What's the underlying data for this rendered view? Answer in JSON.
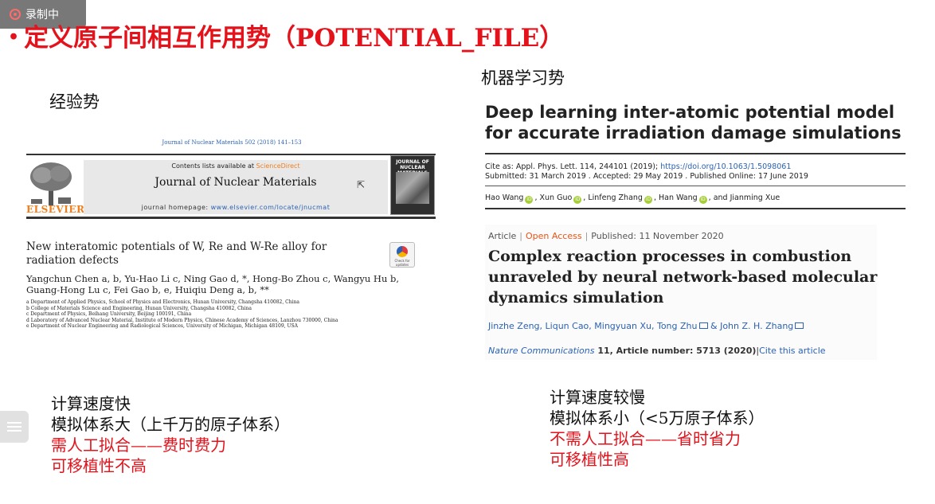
{
  "recording": {
    "label": "录制中"
  },
  "slide": {
    "bullet": "•",
    "title": "定义原子间相互作用势（POTENTIAL_FILE）",
    "left": {
      "heading": "经验势",
      "lines": [
        "计算速度快",
        "模拟体系大（上千万的原子体系）",
        "需人工拟合——费时费力",
        "可移植性不高"
      ]
    },
    "right": {
      "heading": "机器学习势",
      "lines": [
        "计算速度较慢",
        "模拟体系小（<5万原子体系）",
        "不需人工拟合——省时省力",
        "可移植性高"
      ]
    }
  },
  "paper1": {
    "journal_ref": "Journal of Nuclear Materials 502 (2018) 141–153",
    "contents_prefix": "Contents lists available at",
    "contents_link": "ScienceDirect",
    "journal_name": "Journal of Nuclear Materials",
    "homepage_prefix": "journal homepage:",
    "homepage_url": "www.elsevier.com/locate/jnucmat",
    "publisher": "ELSEVIER",
    "cover_title": "JOURNAL OF NUCLEAR MATERIALS",
    "title": "New interatomic potentials of W, Re and W-Re alloy for radiation defects",
    "crossmark": "Check for updates",
    "authors": "Yangchun Chen a, b, Yu-Hao Li c, Ning Gao d, *, Hong-Bo Zhou c, Wangyu Hu b, Guang-Hong Lu c, Fei Gao b, e, Huiqiu Deng a, b, **",
    "affiliations": [
      "a Department of Applied Physics, School of Physics and Electronics, Hunan University, Changsha 410082, China",
      "b College of Materials Science and Engineering, Hunan University, Changsha 410082, China",
      "c Department of Physics, Beihang University, Beijing 100191, China",
      "d Laboratory of Advanced Nuclear Material, Institute of Modern Physics, Chinese Academy of Sciences, Lanzhou 730000, China",
      "e Department of Nuclear Engineering and Radiological Sciences, University of Michigan, Michigan 48109, USA"
    ]
  },
  "paper2": {
    "title_line1": "Deep learning inter-atomic potential model",
    "title_line2": "for accurate irradiation damage simulations",
    "cite_prefix": "Cite as: Appl. Phys. Lett. 114, 244101 (2019); ",
    "cite_doi": "https://doi.org/10.1063/1.5098061",
    "submitted": "Submitted: 31 March 2019 . Accepted: 29 May 2019 . Published Online: 17 June 2019",
    "authors": [
      "Hao Wang",
      "Xun Guo",
      "Linfeng Zhang",
      "Han Wang"
    ],
    "authors_last": ", and Jianming Xue"
  },
  "article2": {
    "type": "Article",
    "access": "Open Access",
    "published": "Published: 11 November 2020",
    "title": "Complex reaction processes in combustion unraveled by neural network-based molecular dynamics simulation",
    "authors_1": "Jinzhe Zeng, Liqun Cao, Mingyuan Xu, Tong Zhu",
    "authors_2": "& John Z. H. Zhang",
    "journal": "Nature Communications",
    "volume_info": " 11, Article number: 5713 (2020)",
    "cite_link": "Cite this article"
  },
  "colors": {
    "title_red": "#e3121b",
    "link_blue": "#2a62b5",
    "elsevier_orange": "#f07f1e",
    "open_access": "#e8541a"
  }
}
